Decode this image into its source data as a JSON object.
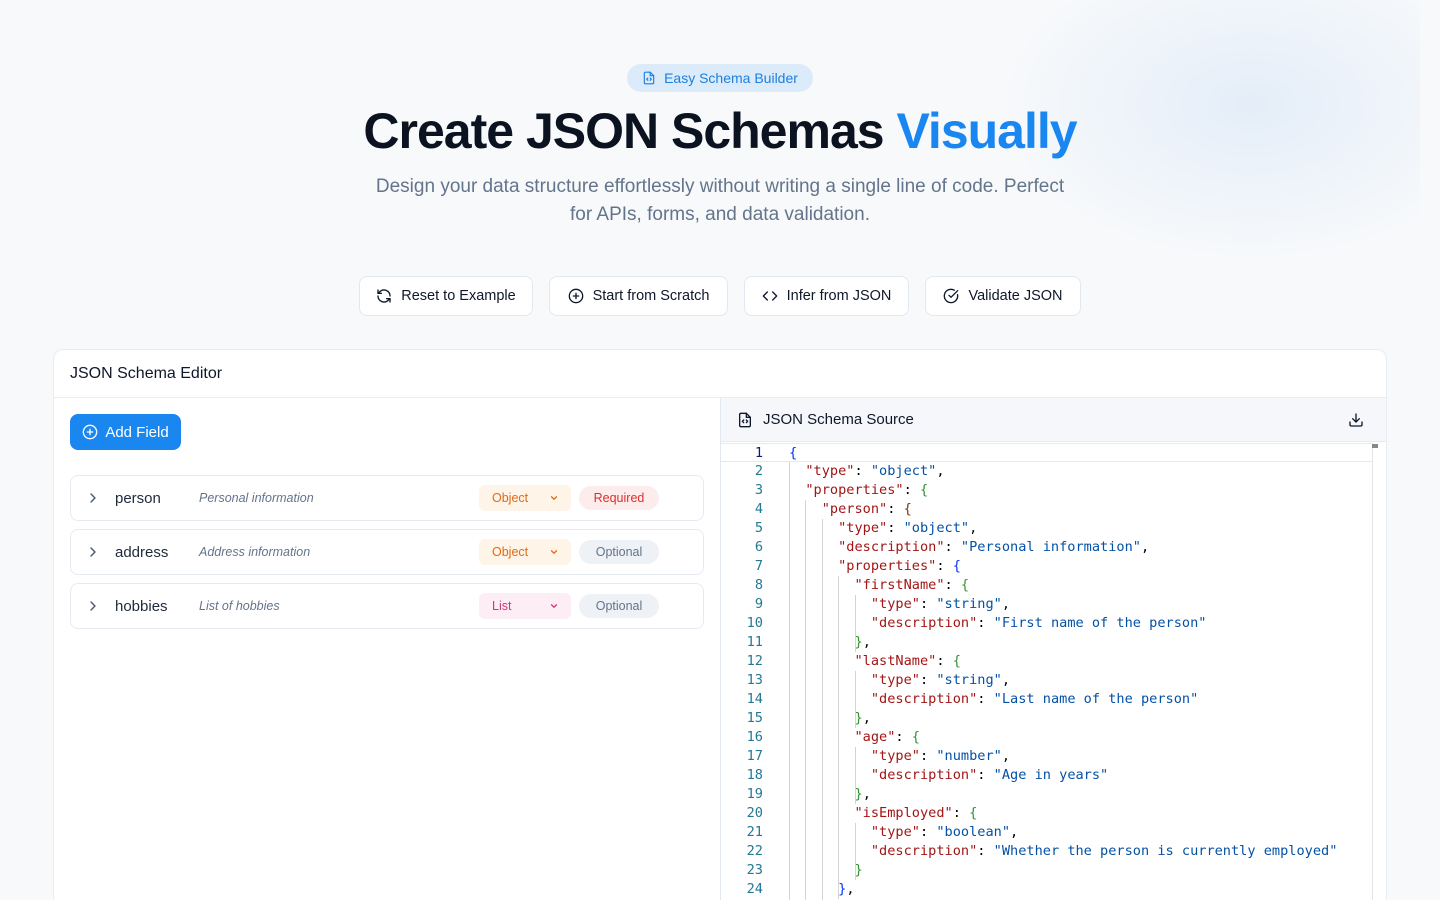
{
  "hero": {
    "badge": "Easy Schema Builder",
    "title_main": "Create JSON Schemas",
    "title_accent": "Visually",
    "subtitle": "Design your data structure effortlessly without writing a single line of code. Perfect for APIs, forms, and data validation."
  },
  "actions": {
    "reset": "Reset to Example",
    "scratch": "Start from Scratch",
    "infer": "Infer from JSON",
    "validate": "Validate JSON"
  },
  "editor": {
    "title": "JSON Schema Editor",
    "add_field": "Add Field",
    "fields": [
      {
        "name": "person",
        "description": "Personal information",
        "type": "Object",
        "status": "Required"
      },
      {
        "name": "address",
        "description": "Address information",
        "type": "Object",
        "status": "Optional"
      },
      {
        "name": "hobbies",
        "description": "List of hobbies",
        "type": "List",
        "status": "Optional"
      }
    ]
  },
  "source": {
    "title": "JSON Schema Source",
    "lines": [
      {
        "n": "1",
        "t": "{"
      },
      {
        "n": "2",
        "t": "  \"type\": \"object\","
      },
      {
        "n": "3",
        "t": "  \"properties\": {"
      },
      {
        "n": "4",
        "t": "    \"person\": {"
      },
      {
        "n": "5",
        "t": "      \"type\": \"object\","
      },
      {
        "n": "6",
        "t": "      \"description\": \"Personal information\","
      },
      {
        "n": "7",
        "t": "      \"properties\": {"
      },
      {
        "n": "8",
        "t": "        \"firstName\": {"
      },
      {
        "n": "9",
        "t": "          \"type\": \"string\","
      },
      {
        "n": "10",
        "t": "          \"description\": \"First name of the person\""
      },
      {
        "n": "11",
        "t": "        },"
      },
      {
        "n": "12",
        "t": "        \"lastName\": {"
      },
      {
        "n": "13",
        "t": "          \"type\": \"string\","
      },
      {
        "n": "14",
        "t": "          \"description\": \"Last name of the person\""
      },
      {
        "n": "15",
        "t": "        },"
      },
      {
        "n": "16",
        "t": "        \"age\": {"
      },
      {
        "n": "17",
        "t": "          \"type\": \"number\","
      },
      {
        "n": "18",
        "t": "          \"description\": \"Age in years\""
      },
      {
        "n": "19",
        "t": "        },"
      },
      {
        "n": "20",
        "t": "        \"isEmployed\": {"
      },
      {
        "n": "21",
        "t": "          \"type\": \"boolean\","
      },
      {
        "n": "22",
        "t": "          \"description\": \"Whether the person is currently employed\""
      },
      {
        "n": "23",
        "t": "        }"
      },
      {
        "n": "24",
        "t": "      },"
      }
    ]
  },
  "icons": {
    "badge": "file-code-icon",
    "reset": "refresh-icon",
    "scratch": "plus-circle-icon",
    "infer": "code-icon",
    "validate": "check-circle-icon",
    "add": "plus-circle-icon",
    "expand": "chevron-right-icon",
    "dropdown": "chevron-down-icon",
    "source": "file-code-icon",
    "download": "download-icon"
  },
  "colors": {
    "accent": "#1a86f0",
    "object_type": "#e36a12",
    "list_type": "#d6347c",
    "required": "#dc2f2f"
  }
}
